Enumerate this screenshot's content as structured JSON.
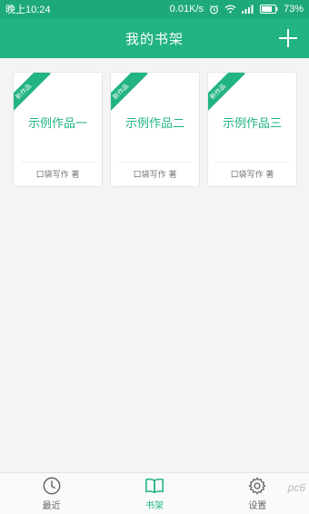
{
  "status_bar": {
    "time": "晚上10:24",
    "speed": "0.01K/s",
    "battery": "73%",
    "icons": [
      "alarm-icon",
      "wifi-icon",
      "signal-icon",
      "battery-icon"
    ]
  },
  "app_bar": {
    "title": "我的书架",
    "add_icon": "plus-icon"
  },
  "books": [
    {
      "ribbon": "新作品",
      "title": "示例作品一",
      "author": "口袋写作 著"
    },
    {
      "ribbon": "新作品",
      "title": "示例作品二",
      "author": "口袋写作 著"
    },
    {
      "ribbon": "新作品",
      "title": "示例作品三",
      "author": "口袋写作 著"
    }
  ],
  "bottom_nav": {
    "items": [
      {
        "label": "最近",
        "icon": "clock-icon",
        "active": false
      },
      {
        "label": "书架",
        "icon": "book-icon",
        "active": true
      },
      {
        "label": "设置",
        "icon": "gear-icon",
        "active": false
      }
    ]
  },
  "colors": {
    "accent": "#22b384",
    "status_bar": "#1ea97c"
  },
  "watermark": "pc6"
}
